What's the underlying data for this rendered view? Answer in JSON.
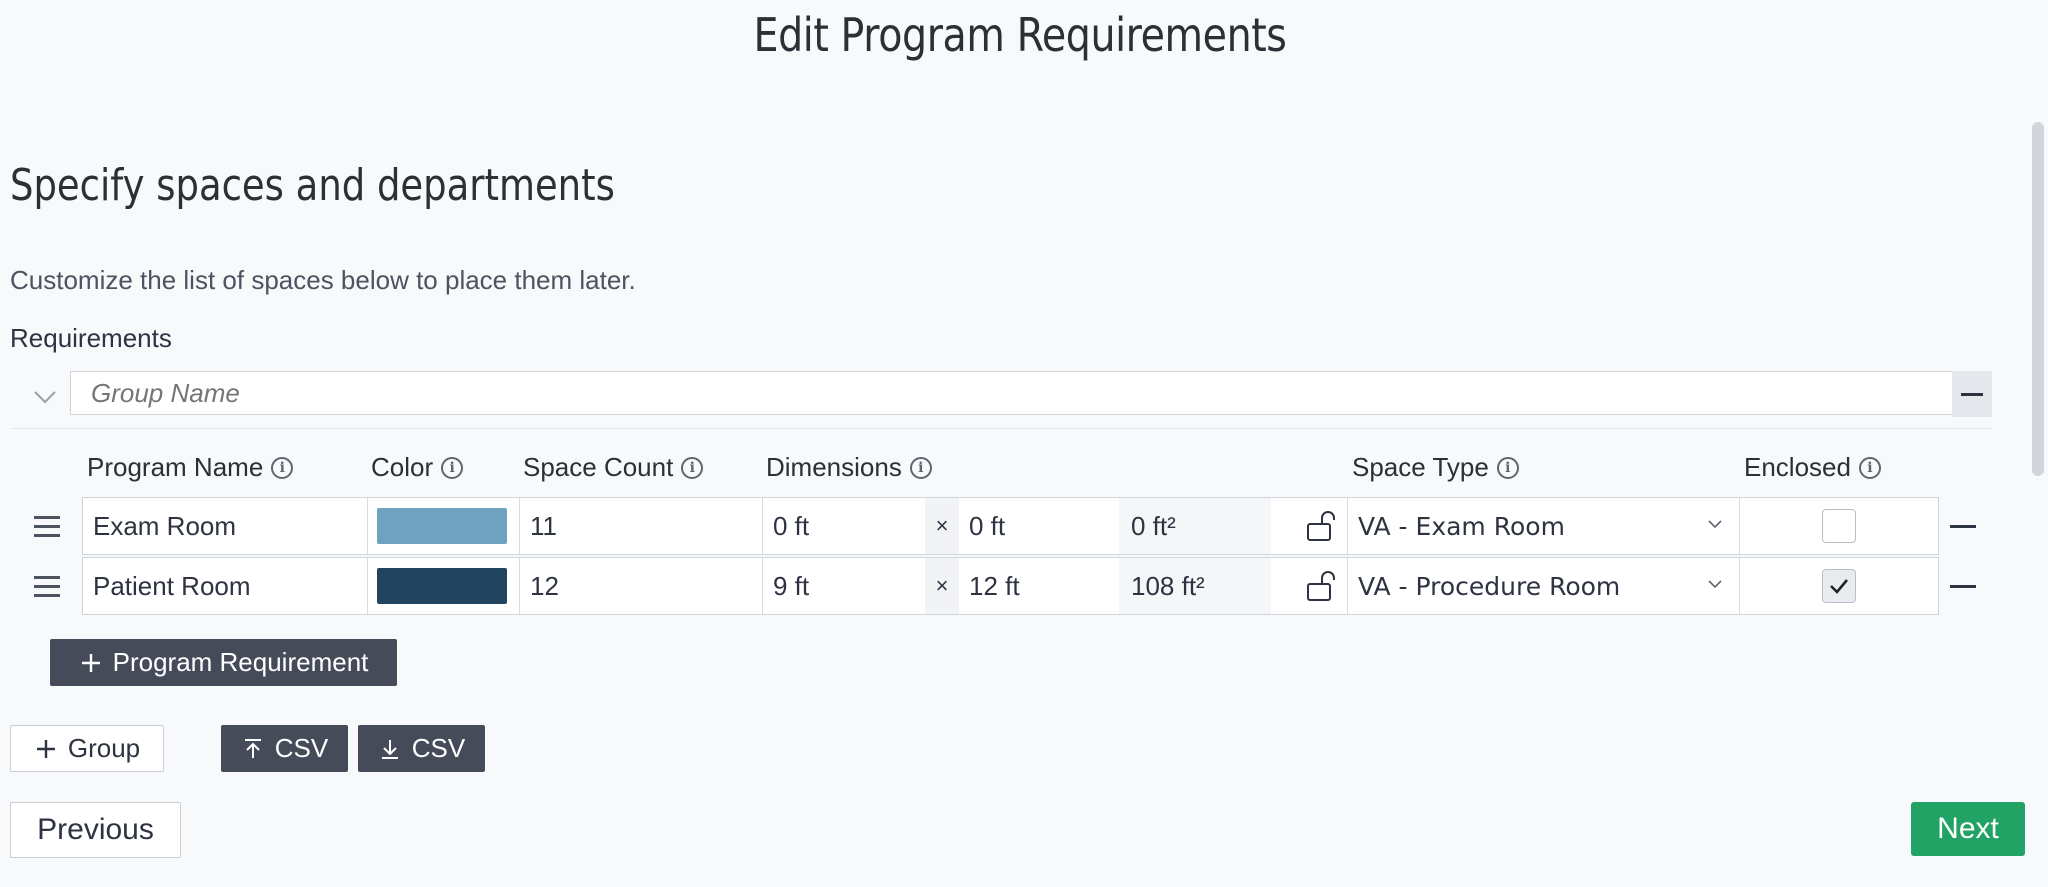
{
  "page": {
    "title": "Edit Program Requirements",
    "section_title": "Specify spaces and departments",
    "section_description": "Customize the list of spaces below to place them later.",
    "requirements_label": "Requirements"
  },
  "group": {
    "name_placeholder": "Group Name",
    "name_value": ""
  },
  "columns": {
    "program_name": "Program Name",
    "color": "Color",
    "space_count": "Space Count",
    "dimensions": "Dimensions",
    "space_type": "Space Type",
    "enclosed": "Enclosed"
  },
  "rows": [
    {
      "program_name": "Exam Room",
      "color": "#6fa2c0",
      "space_count": "11",
      "width": "0 ft",
      "times": "×",
      "length": "0 ft",
      "area": "0 ft²",
      "space_type": "VA - Exam Room",
      "enclosed": false
    },
    {
      "program_name": "Patient Room",
      "color": "#22455f",
      "space_count": "12",
      "width": "9 ft",
      "times": "×",
      "length": "12 ft",
      "area": "108 ft²",
      "space_type": "VA - Procedure Room",
      "enclosed": true
    }
  ],
  "buttons": {
    "add_program_requirement": "Program Requirement",
    "add_group": "Group",
    "upload_csv": "CSV",
    "download_csv": "CSV",
    "previous": "Previous",
    "next": "Next"
  },
  "colors": {
    "accent_dark": "#454b59",
    "next_green": "#21a366",
    "background": "#f7f9fb"
  },
  "icons": [
    "info-icon",
    "chevron-down-icon",
    "drag-handle-icon",
    "unlock-icon",
    "minus-icon",
    "plus-icon",
    "upload-icon",
    "download-icon",
    "check-icon"
  ]
}
